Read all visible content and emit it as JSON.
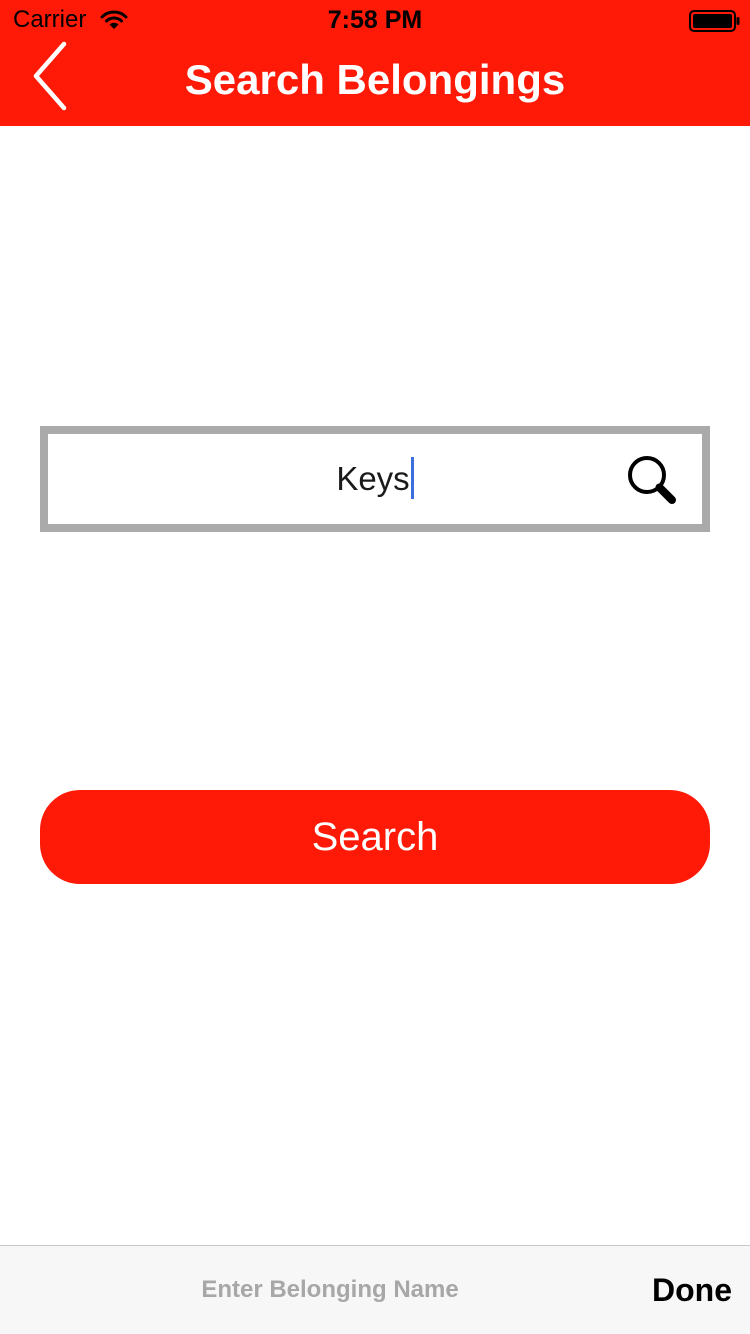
{
  "status_bar": {
    "carrier": "Carrier",
    "time": "7:58 PM",
    "wifi_icon": "wifi-icon",
    "battery_icon": "battery-full-icon"
  },
  "nav": {
    "title": "Search Belongings",
    "back_icon": "chevron-left-icon",
    "background_color": "#ff1a08"
  },
  "search": {
    "value": "Keys",
    "icon": "search-icon",
    "border_color": "#aaaaaa",
    "caret_color": "#3b6fe0"
  },
  "search_button": {
    "label": "Search",
    "color": "#ff1a08"
  },
  "accessory_bar": {
    "placeholder": "Enter Belonging Name",
    "done_label": "Done"
  }
}
